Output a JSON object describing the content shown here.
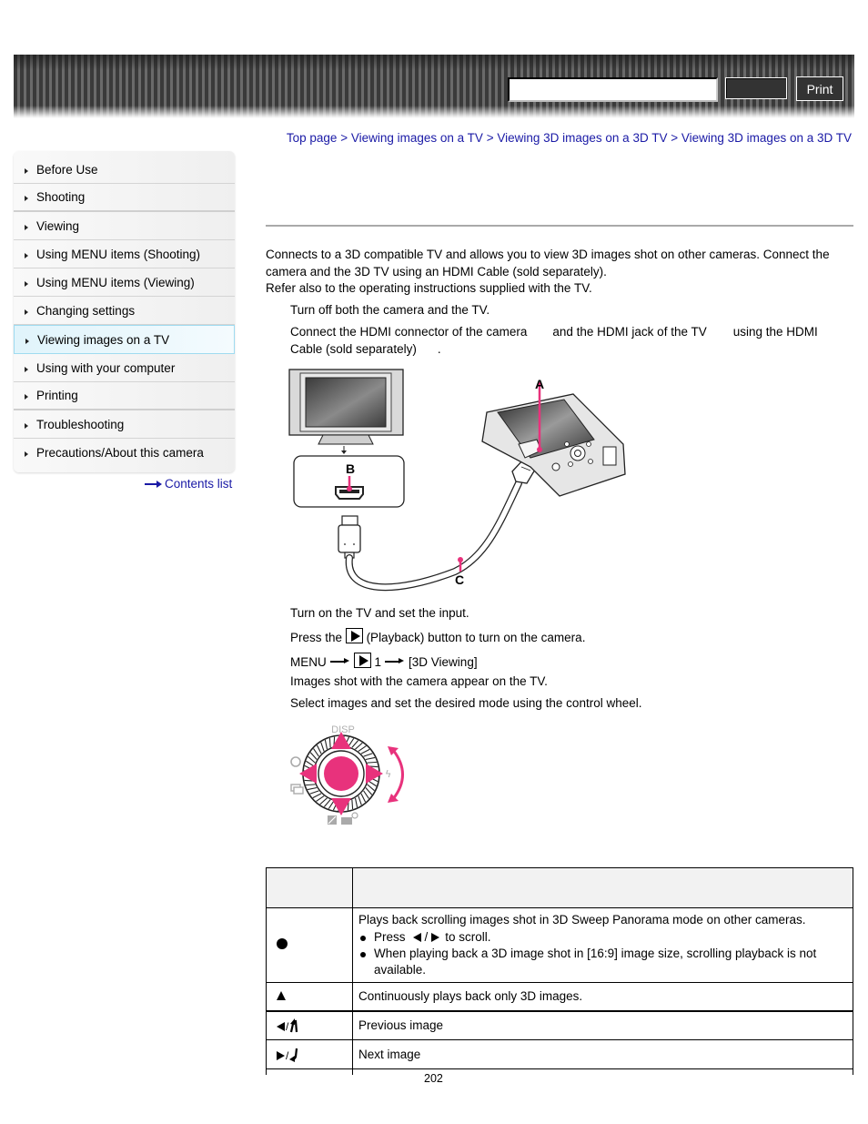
{
  "header": {
    "search_placeholder": "",
    "search_button_label": "",
    "print_label": "Print"
  },
  "sidebar": {
    "items": [
      {
        "label": "Before Use"
      },
      {
        "label": "Shooting"
      },
      {
        "label": "Viewing"
      },
      {
        "label": "Using MENU items (Shooting)"
      },
      {
        "label": "Using MENU items (Viewing)"
      },
      {
        "label": "Changing settings"
      },
      {
        "label": "Viewing images on a TV",
        "active": true
      },
      {
        "label": "Using with your computer"
      },
      {
        "label": "Printing"
      },
      {
        "label": "Troubleshooting"
      },
      {
        "label": "Precautions/About this camera"
      }
    ],
    "contents_link": "Contents list"
  },
  "breadcrumb": {
    "items": [
      "Top page",
      "Viewing images on a TV",
      "Viewing 3D images on a 3D TV",
      "Viewing 3D images on a 3D TV"
    ],
    "separator": ">"
  },
  "intro": {
    "line1": "Connects to a 3D compatible TV and allows you to view 3D images shot on other cameras. Connect the camera and the 3D TV using an HDMI Cable (sold separately).",
    "line2": "Refer also to the operating instructions supplied with the TV."
  },
  "steps": {
    "s1": "Turn off both the camera and the TV.",
    "s2_a": "Connect the HDMI connector of the camera",
    "s2_b": "and the HDMI jack of the TV",
    "s2_c": "using the HDMI",
    "s2_d": "Cable (sold separately)",
    "s2_e": ".",
    "s3": "Turn on the TV and set the input.",
    "s4_a": "Press the",
    "s4_b": "(Playback) button to turn on the camera.",
    "s5_menu": "MENU",
    "s5_num": "1",
    "s5_item": "[3D Viewing]",
    "s5_note": "Images shot with the camera appear on the TV.",
    "s6": "Select images and set the desired mode using the control wheel."
  },
  "diagram_hdmi": {
    "label_a": "A",
    "label_b": "B",
    "label_c": "C",
    "accent_color": "#e8327c"
  },
  "diagram_wheel": {
    "disp_label": "DISP",
    "accent_color": "#e8327c"
  },
  "table": {
    "header": {
      "icon": "",
      "description": ""
    },
    "rows": [
      {
        "icon": "center-button-dot",
        "description": "Plays back scrolling images shot in 3D Sweep Panorama mode on other cameras.",
        "bullets": [
          {
            "pre": "Press",
            "sep": "/",
            "post": "to scroll."
          },
          {
            "text": "When playing back a 3D image shot in [16:9] image size, scrolling playback is not available."
          }
        ]
      },
      {
        "icon": "up-triangle",
        "description": "Continuously plays back only 3D images."
      },
      {
        "icon": "left-triangle / rotate-counterclockwise",
        "description": "Previous image",
        "slash": "/"
      },
      {
        "icon": "right-triangle / rotate-clockwise",
        "description": "Next image",
        "slash": "/"
      }
    ]
  },
  "page_number": "202"
}
